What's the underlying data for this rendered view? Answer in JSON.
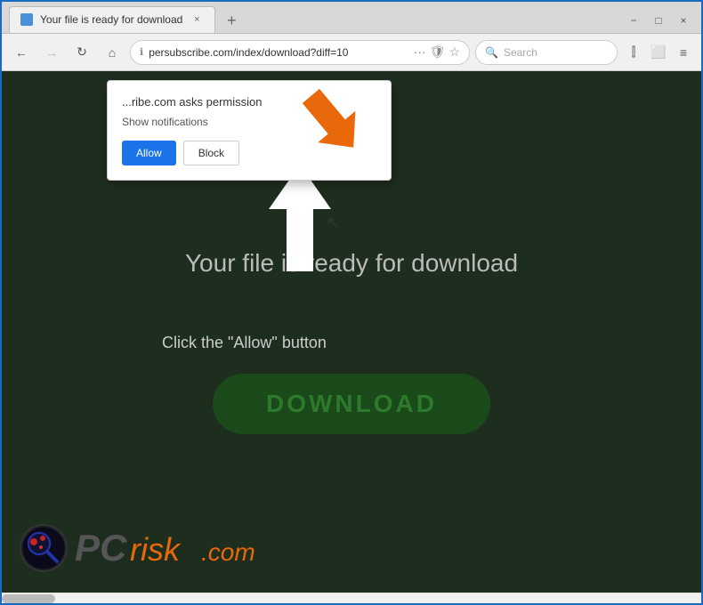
{
  "browser": {
    "tab": {
      "title": "Your file is ready for download",
      "close_label": "×",
      "new_tab_label": "+"
    },
    "window_controls": {
      "minimize": "−",
      "maximize": "□",
      "close": "×"
    },
    "toolbar": {
      "back_label": "←",
      "forward_label": "→",
      "reload_label": "↻",
      "home_label": "⌂",
      "url": "persubscribe.com/index/download?diff=10",
      "more_label": "···",
      "search_placeholder": "Search",
      "bookmark_label": "☆",
      "extensions_label": "≡"
    }
  },
  "popup": {
    "title": "...ribe.com asks permission",
    "subtitle": "Show notifications",
    "allow_label": "Allow",
    "block_label": "Block"
  },
  "page": {
    "heading": "Your file is ready for download",
    "instruction": "Click the \"Allow\" button",
    "download_label": "DOWNLOAD"
  },
  "logo": {
    "pc_text": "PC",
    "risk_text": "risk",
    "com_text": ".com"
  },
  "colors": {
    "browser_border": "#1a6bbf",
    "allow_btn": "#1a73e8",
    "download_btn_bg": "#1a4a1a",
    "download_btn_text": "#2d7a2d",
    "page_bg": "#1e2e1e",
    "orange_arrow": "#e8680a"
  }
}
